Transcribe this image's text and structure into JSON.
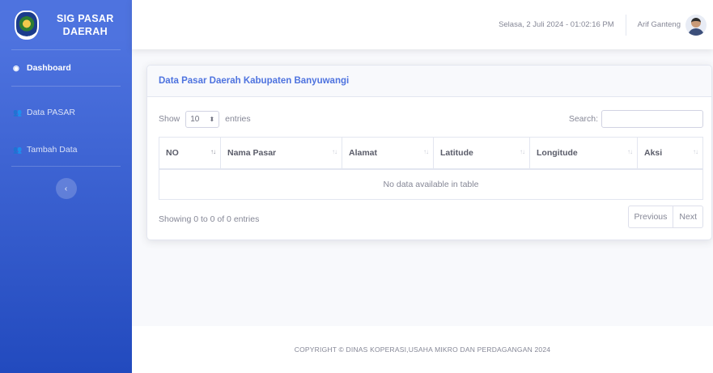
{
  "brand": {
    "line1": "SIG PASAR",
    "line2": "DAERAH"
  },
  "sidebar": {
    "items": [
      {
        "label": "Dashboard",
        "icon": "tachometer-icon",
        "active": true
      },
      {
        "label": "Data PASAR",
        "icon": "users-icon",
        "active": false
      },
      {
        "label": "Tambah Data",
        "icon": "users-icon",
        "active": false
      }
    ],
    "toggle_icon": "chevron-left-icon"
  },
  "topbar": {
    "datetime": "Selasa, 2 Juli 2024  -  01:02:16 PM",
    "user_name": "Arif Ganteng"
  },
  "card": {
    "title": "Data Pasar Daerah Kabupaten Banyuwangi",
    "show_label": "Show",
    "entries_value": "10",
    "entries_label": "entries",
    "search_label": "Search:",
    "search_value": "",
    "columns": [
      "NO",
      "Nama Pasar",
      "Alamat",
      "Latitude",
      "Longitude",
      "Aksi"
    ],
    "empty_message": "No data available in table",
    "info": "Showing 0 to 0 of 0 entries",
    "prev_label": "Previous",
    "next_label": "Next"
  },
  "footer": {
    "copyright": "COPYRIGHT © DINAS KOPERASI,USAHA MIKRO DAN PERDAGANGAN 2024"
  },
  "colors": {
    "primary": "#4e73df",
    "sidebar_bottom": "#224abe",
    "text_muted": "#858796"
  }
}
